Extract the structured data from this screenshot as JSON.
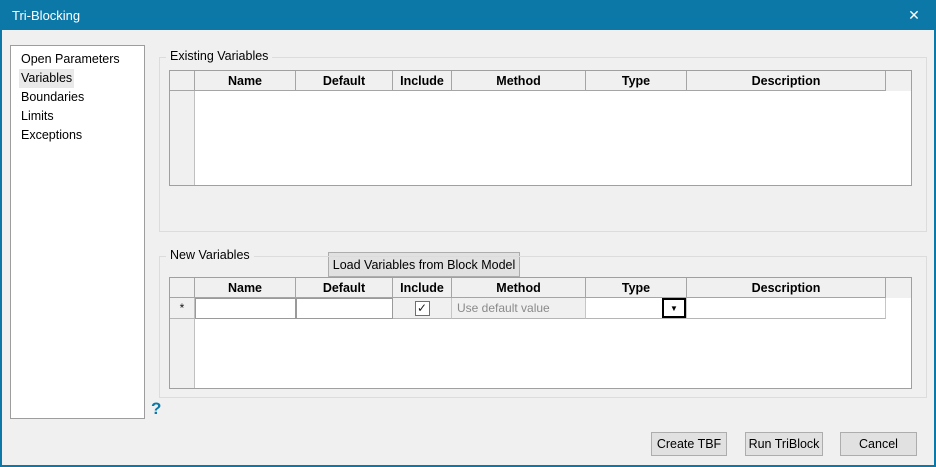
{
  "window": {
    "title": "Tri-Blocking"
  },
  "icons": {
    "close": "✕",
    "dropdown_arrow": "▼",
    "help": "?",
    "check": "✓"
  },
  "colors": {
    "titlebar": "#0c78a8",
    "dialog_border": "#0c78a8",
    "client_background": "#f0f0f0",
    "help_icon": "#0d78a8"
  },
  "sidebar": {
    "items": [
      {
        "label": "Open Parameters",
        "selected": false
      },
      {
        "label": "Variables",
        "selected": true
      },
      {
        "label": "Boundaries",
        "selected": false
      },
      {
        "label": "Limits",
        "selected": false
      },
      {
        "label": "Exceptions",
        "selected": false
      }
    ]
  },
  "columns": [
    "Name",
    "Default",
    "Include",
    "Method",
    "Type",
    "Description"
  ],
  "existing_variables": {
    "group_label": "Existing Variables",
    "rows": [],
    "load_button_label": "Load Variables from Block Model"
  },
  "new_variables": {
    "group_label": "New Variables",
    "row": {
      "marker": "*",
      "name": "",
      "default": "",
      "include_checked": true,
      "method": "Use default value",
      "type": "",
      "description": ""
    }
  },
  "footer": {
    "create_tbf_label": "Create TBF",
    "run_triblock_label": "Run TriBlock",
    "cancel_label": "Cancel"
  }
}
